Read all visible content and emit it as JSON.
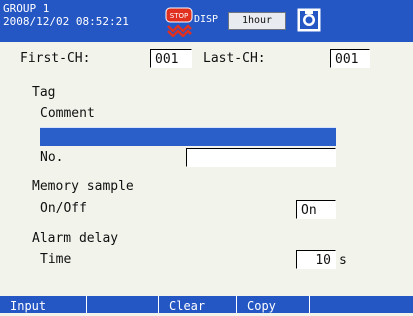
{
  "header": {
    "group_label": "GROUP 1",
    "datetime": "2008/12/02 08:52:21",
    "disp_label": "DISP",
    "interval_value": "1hour"
  },
  "form": {
    "first_ch_label": "First-CH:",
    "first_ch_value": "001",
    "last_ch_label": "Last-CH:",
    "last_ch_value": "001",
    "tag_section": "Tag",
    "comment_label": "Comment",
    "comment_value": "",
    "no_label": "No.",
    "no_value": "",
    "memory_section": "Memory sample",
    "onoff_label": "On/Off",
    "onoff_value": "On",
    "alarm_section": "Alarm delay",
    "time_label": "Time",
    "time_value": "10",
    "time_unit": "s"
  },
  "softkeys": [
    "Input",
    "",
    "Clear",
    "Copy"
  ],
  "colors": {
    "status_bar": "#2456c4",
    "highlight": "#2a5ec8",
    "background": "#f2f4ec"
  },
  "icons": [
    "stop-status-icon",
    "save-icon"
  ]
}
